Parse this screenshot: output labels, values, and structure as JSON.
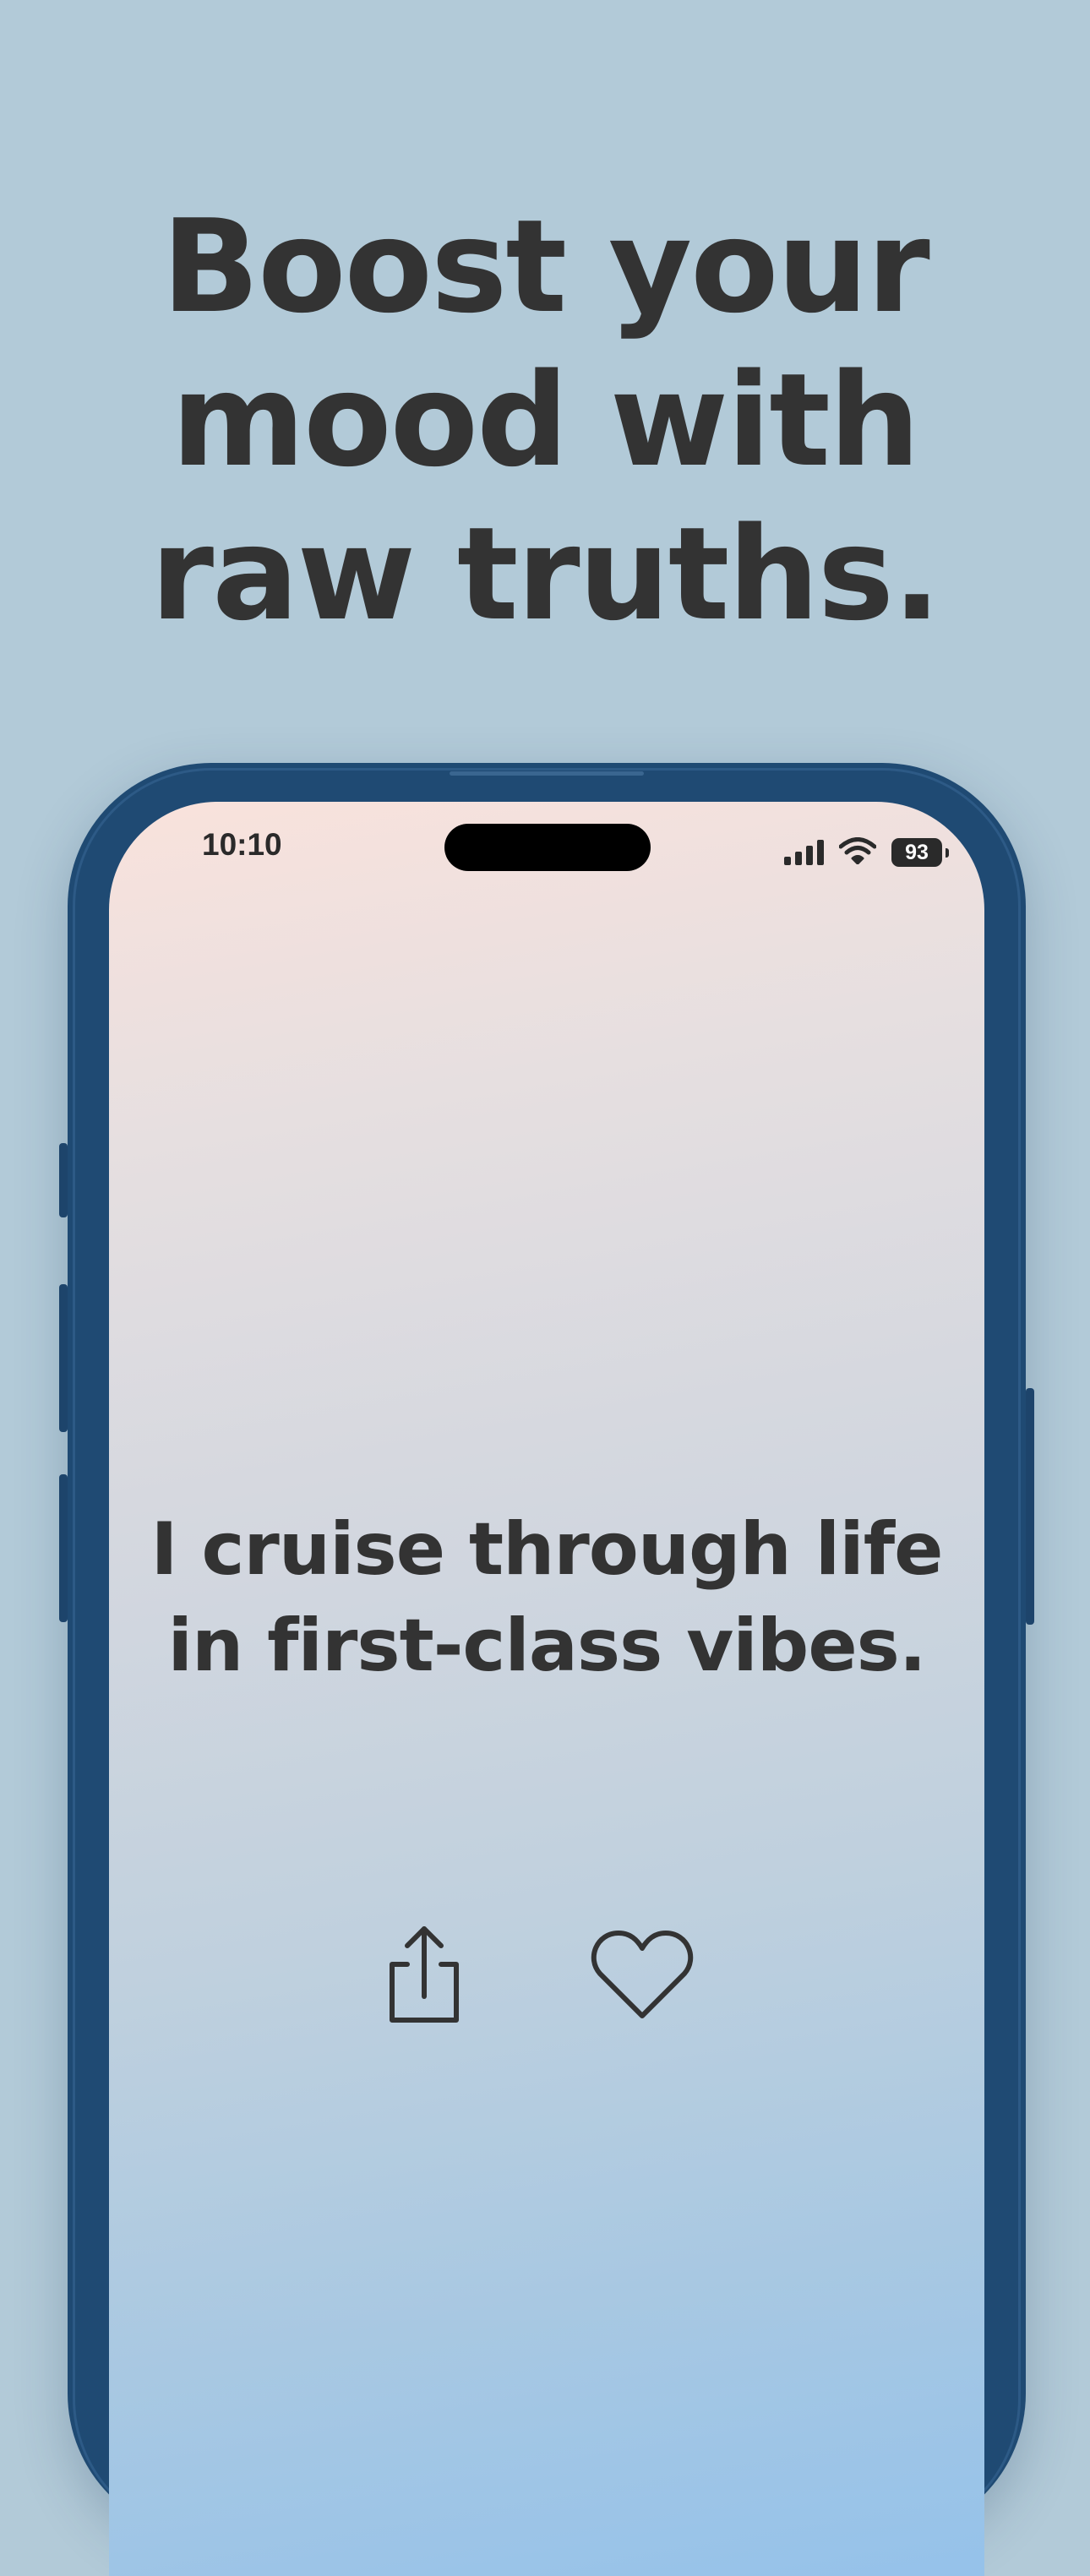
{
  "headline": {
    "lines": [
      "Boost your",
      "mood with",
      "raw truths."
    ]
  },
  "status_bar": {
    "time": "10:10",
    "battery_level": "93",
    "icons": [
      "cellular-signal-icon",
      "wifi-icon",
      "battery-icon"
    ]
  },
  "quote": {
    "lines": [
      "I cruise through life",
      "in first-class vibes."
    ]
  },
  "actions": {
    "icons": [
      "share-icon",
      "heart-icon"
    ]
  },
  "colors": {
    "page_background": "#b2cad8",
    "phone_frame": "#1f4a73",
    "text": "#333333",
    "screen_gradient_top": "#f9e2dc",
    "screen_gradient_bottom": "#95c2ea"
  }
}
